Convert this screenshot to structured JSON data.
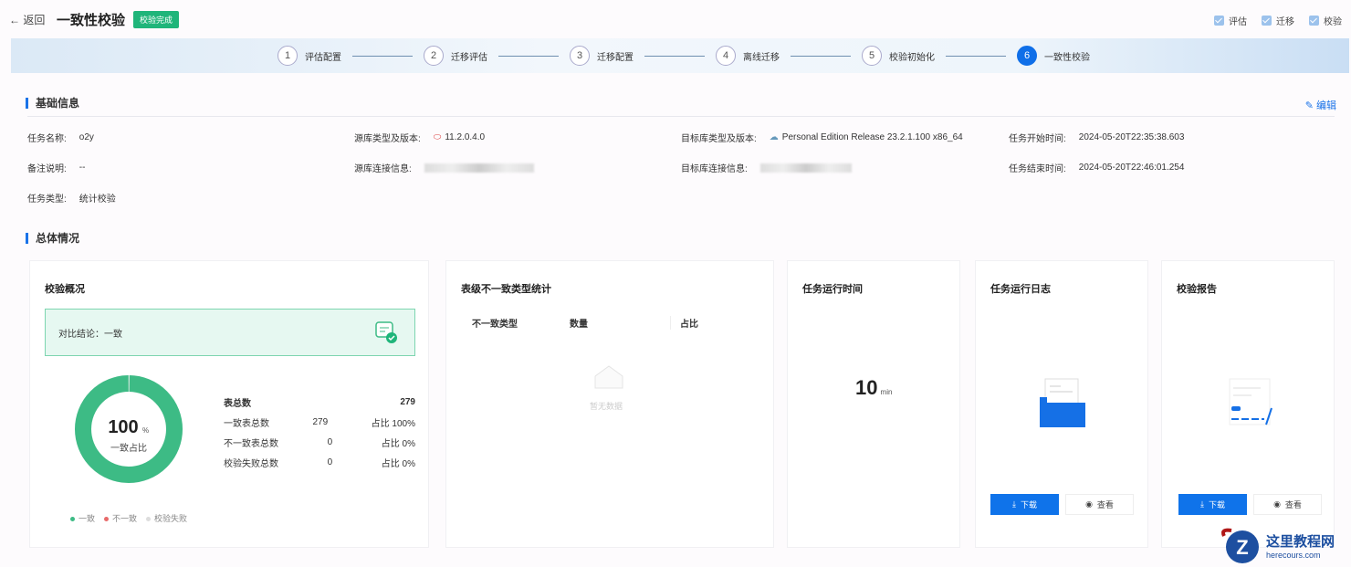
{
  "header": {
    "back": "← 返回",
    "title": "一致性校验",
    "badge": "校验完成",
    "checks": [
      "评估",
      "迁移",
      "校验"
    ]
  },
  "steps": [
    {
      "n": "1",
      "label": "评估配置"
    },
    {
      "n": "2",
      "label": "迁移评估"
    },
    {
      "n": "3",
      "label": "迁移配置"
    },
    {
      "n": "4",
      "label": "离线迁移"
    },
    {
      "n": "5",
      "label": "校验初始化"
    },
    {
      "n": "6",
      "label": "一致性校验"
    }
  ],
  "basic": {
    "title": "基础信息",
    "edit": "编辑",
    "task_name_k": "任务名称:",
    "task_name": "o2y",
    "note_k": "备注说明:",
    "note": "--",
    "type_k": "任务类型:",
    "type": "统计校验",
    "src_k": "源库类型及版本:",
    "src": "11.2.0.4.0",
    "src_conn_k": "源库连接信息:",
    "dst_k": "目标库类型及版本:",
    "dst": "Personal Edition Release 23.2.1.100 x86_64",
    "dst_conn_k": "目标库连接信息:",
    "start_k": "任务开始时间:",
    "start": "2024-05-20T22:35:38.603",
    "end_k": "任务结束时间:",
    "end": "2024-05-20T22:46:01.254"
  },
  "overall": {
    "title": "总体情况"
  },
  "overview": {
    "title": "校验概况",
    "result": "对比结论：一致",
    "percent": "100",
    "pct_unit": "%",
    "pct_label": "一致占比",
    "consistent_fraction": 1.0,
    "rows": [
      {
        "k": "表总数",
        "v": "",
        "r": "279"
      },
      {
        "k": "一致表总数",
        "v": "279",
        "r": "占比 100%"
      },
      {
        "k": "不一致表总数",
        "v": "0",
        "r": "占比 0%"
      },
      {
        "k": "校验失败总数",
        "v": "0",
        "r": "占比 0%"
      }
    ],
    "legend": [
      "一致",
      "不一致",
      "校验失败"
    ],
    "colors": {
      "ok": "#3dbb85",
      "bad": "#e86a6a",
      "fail": "#dddddd"
    }
  },
  "mismatch": {
    "title": "表级不一致类型统计",
    "cols": [
      "不一致类型",
      "数量",
      "占比"
    ],
    "empty": "暂无数据"
  },
  "runtime": {
    "title": "任务运行时间",
    "value": "10",
    "unit": "min"
  },
  "log": {
    "title": "任务运行日志",
    "download": "下载",
    "view": "查看"
  },
  "report": {
    "title": "校验报告",
    "download": "下载",
    "view": "查看"
  },
  "watermark": {
    "cn": "这里教程网",
    "en": "herecours.com"
  }
}
